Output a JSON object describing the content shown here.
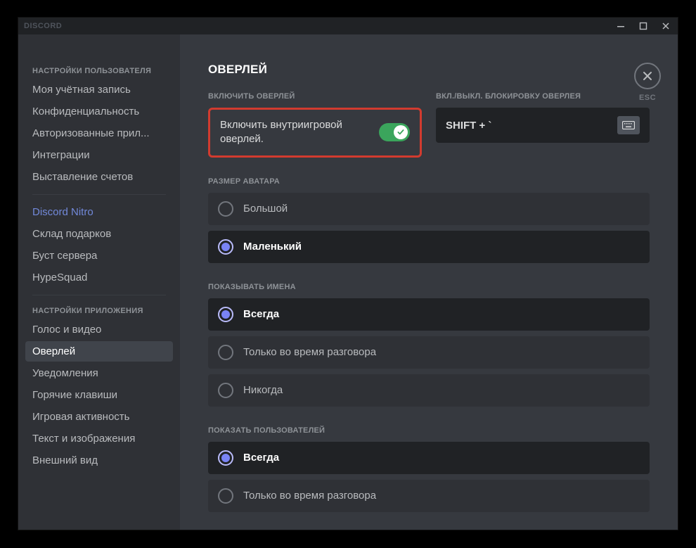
{
  "titlebar": {
    "brand": "DISCORD"
  },
  "esc": {
    "label": "ESC"
  },
  "sidebar": {
    "userHeader": "НАСТРОЙКИ ПОЛЬЗОВАТЕЛЯ",
    "userItems": [
      "Моя учётная запись",
      "Конфиденциальность",
      "Авторизованные прил...",
      "Интеграции",
      "Выставление счетов"
    ],
    "nitroItems": [
      "Discord Nitro",
      "Склад подарков",
      "Буст сервера",
      "HypeSquad"
    ],
    "appHeader": "НАСТРОЙКИ ПРИЛОЖЕНИЯ",
    "appItems": [
      "Голос и видео",
      "Оверлей",
      "Уведомления",
      "Горячие клавиши",
      "Игровая активность",
      "Текст и изображения",
      "Внешний вид"
    ],
    "selected": "Оверлей"
  },
  "page": {
    "title": "ОВЕРЛЕЙ",
    "enable": {
      "label": "ВКЛЮЧИТЬ ОВЕРЛЕЙ",
      "toggleText": "Включить внутриигровой оверлей.",
      "on": true
    },
    "lock": {
      "label": "ВКЛ./ВЫКЛ. БЛОКИРОВКУ ОВЕРЛЕЯ",
      "value": "SHIFT + `"
    },
    "avatarSize": {
      "label": "РАЗМЕР АВАТАРА",
      "options": [
        "Большой",
        "Маленький"
      ],
      "selected": "Маленький"
    },
    "showNames": {
      "label": "ПОКАЗЫВАТЬ ИМЕНА",
      "options": [
        "Всегда",
        "Только во время разговора",
        "Никогда"
      ],
      "selected": "Всегда"
    },
    "showUsers": {
      "label": "ПОКАЗАТЬ ПОЛЬЗОВАТЕЛЕЙ",
      "options": [
        "Всегда",
        "Только во время разговора"
      ],
      "selected": "Всегда"
    }
  }
}
